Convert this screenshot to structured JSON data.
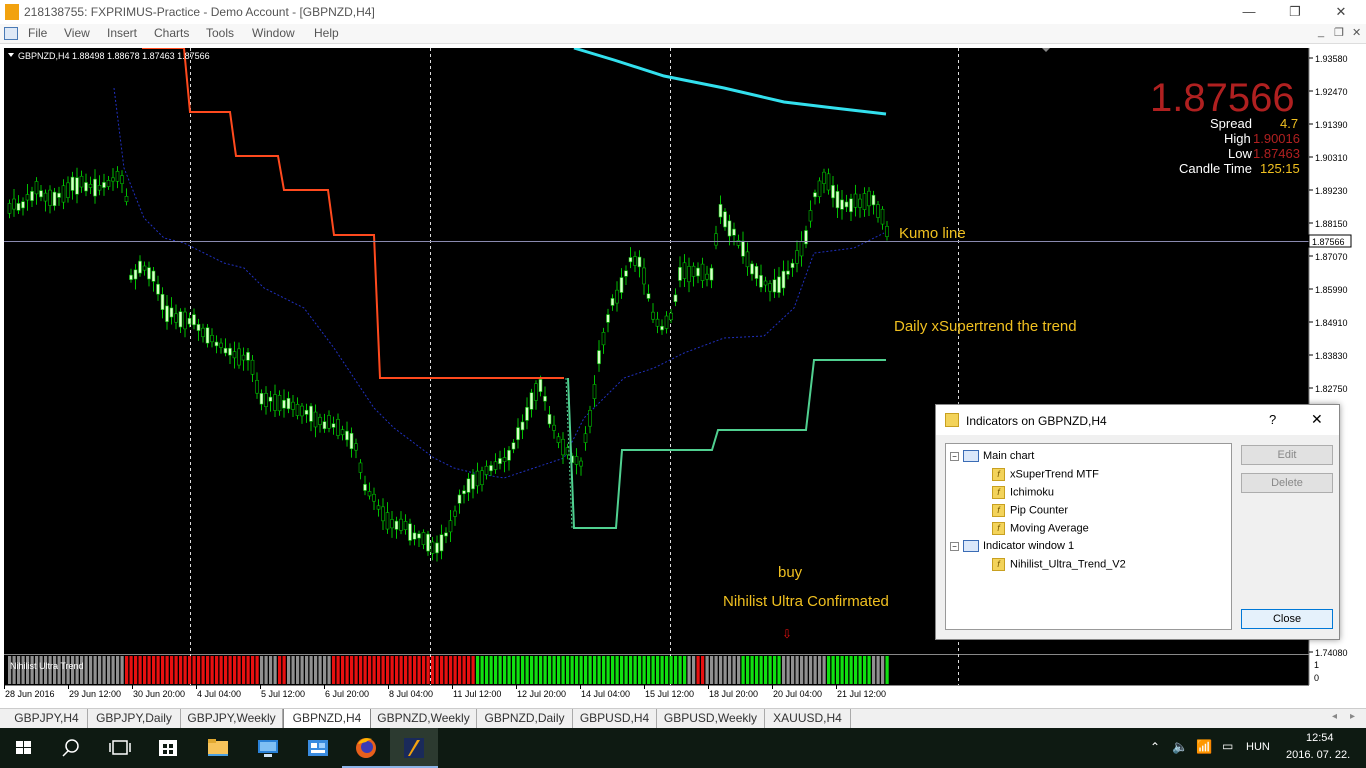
{
  "window": {
    "title": "218138755: FXPRIMUS-Practice - Demo Account - [GBPNZD,H4]",
    "minimize_label": "—",
    "restore_label": "❐",
    "close_label": "✕"
  },
  "menu": {
    "items": [
      "File",
      "View",
      "Insert",
      "Charts",
      "Tools",
      "Window",
      "Help"
    ],
    "mdi_buttons": [
      "_",
      "❐",
      "✕"
    ]
  },
  "chart": {
    "symbol_header": "GBPNZD,H4  1.88498 1.88678 1.87463 1.87566",
    "price_big": "1.87566",
    "spread_label": "Spread",
    "spread_value": "4.7",
    "high_label": "High",
    "high_value": "1.90016",
    "low_label": "Low",
    "low_value": "1.87463",
    "candle_time_label": "Candle Time",
    "candle_time_value": "125:15",
    "current_price_tag": "1.87566",
    "annotations": {
      "kumo": "Kumo line",
      "daily": "Daily xSupertrend the  trend",
      "buy": "buy",
      "nihilist": "Nihilist Ultra Confirmated"
    },
    "subwindow_label": "Nihilist Ultra Trend",
    "subwindow_scale": [
      "1",
      "0"
    ],
    "price_axis": [
      "1.93580",
      "1.92470",
      "1.91390",
      "1.90310",
      "1.89230",
      "1.88150",
      "1.87070",
      "1.85990",
      "1.84910",
      "1.83830",
      "1.82750",
      "1.74080"
    ],
    "time_axis": [
      "28 Jun 2016",
      "29 Jun 12:00",
      "30 Jun 20:00",
      "4 Jul 04:00",
      "5 Jul 12:00",
      "6 Jul 20:00",
      "8 Jul 04:00",
      "11 Jul 12:00",
      "12 Jul 20:00",
      "14 Jul 04:00",
      "15 Jul 12:00",
      "18 Jul 20:00",
      "20 Jul 04:00",
      "21 Jul 12:00"
    ],
    "colors": {
      "background": "#000000",
      "bull_candle": "#d8ffc8",
      "wick": "#00c000",
      "supertrend_red": "#ff4a1e",
      "supertrend_green": "#50d090",
      "ma_cyan": "#33e0ee",
      "kumo_dotted": "#2030c0",
      "annotation_text": "#f0c020",
      "price_big": "#b02020"
    }
  },
  "dialog": {
    "title": "Indicators on GBPNZD,H4",
    "help": "?",
    "close_x": "✕",
    "tree": [
      {
        "label": "Main chart",
        "type": "folder"
      },
      {
        "label": "xSuperTrend MTF",
        "type": "indicator"
      },
      {
        "label": "Ichimoku",
        "type": "indicator"
      },
      {
        "label": "Pip Counter",
        "type": "indicator"
      },
      {
        "label": "Moving Average",
        "type": "indicator"
      },
      {
        "label": "Indicator window 1",
        "type": "folder"
      },
      {
        "label": "Nihilist_Ultra_Trend_V2",
        "type": "indicator"
      }
    ],
    "buttons": {
      "edit": "Edit",
      "delete": "Delete",
      "close": "Close"
    }
  },
  "tabs": [
    "GBPJPY,H4",
    "GBPJPY,Daily",
    "GBPJPY,Weekly",
    "GBPNZD,H4",
    "GBPNZD,Weekly",
    "GBPNZD,Daily",
    "GBPUSD,H4",
    "GBPUSD,Weekly",
    "XAUUSD,H4"
  ],
  "active_tab": "GBPNZD,H4",
  "taskbar": {
    "time": "12:54",
    "date": "2016. 07. 22.",
    "lang": "HUN"
  }
}
